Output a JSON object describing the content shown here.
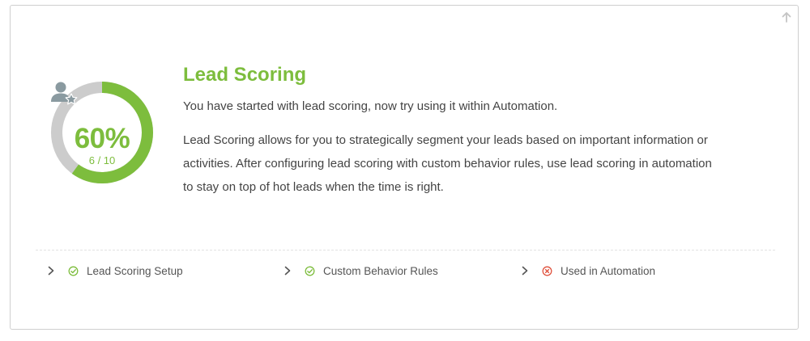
{
  "card": {
    "title": "Lead Scoring",
    "subtitle": "You have started with lead scoring, now try using it within Automation.",
    "description": "Lead Scoring allows for you to strategically segment your leads based on important information or activities. After configuring lead scoring with custom behavior rules, use lead scoring in automation to stay on top of hot leads when the time is right."
  },
  "progress": {
    "percent_label": "60%",
    "fraction_label": "6 / 10",
    "value": 0.6,
    "complete_color": "#7dbd3d",
    "remaining_color": "#cccccc"
  },
  "icons": {
    "collapse": "arrow-up-icon",
    "center": "user-star-icon",
    "expand": "chevron-right-icon",
    "done": "check-circle-icon",
    "not_done": "x-circle-icon"
  },
  "checklist": [
    {
      "label": "Lead Scoring Setup",
      "status": "complete"
    },
    {
      "label": "Custom Behavior Rules",
      "status": "complete"
    },
    {
      "label": "Used in Automation",
      "status": "incomplete"
    }
  ],
  "status_colors": {
    "complete": "#7dbd3d",
    "incomplete": "#e0533f"
  }
}
